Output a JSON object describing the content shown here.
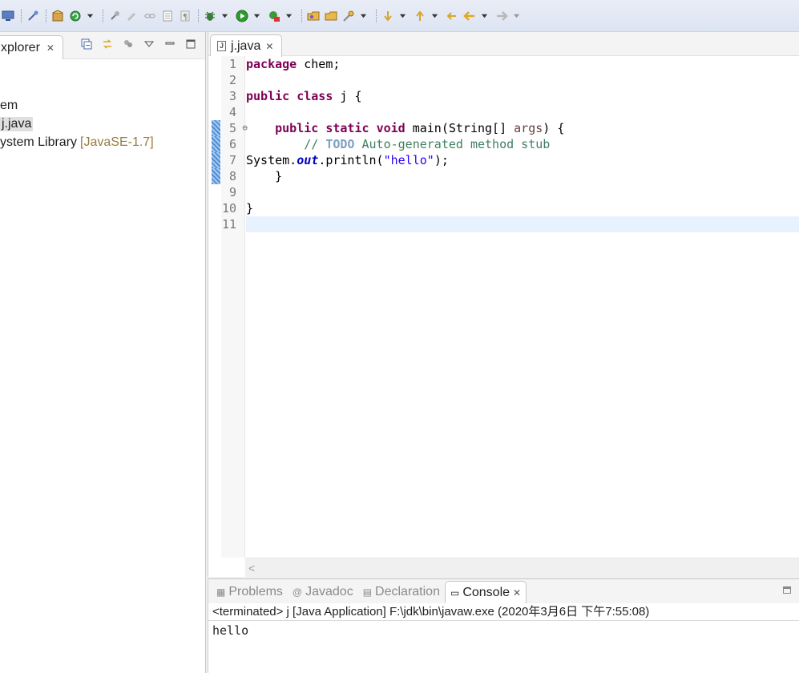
{
  "toolbar": {
    "icons": [
      "desktop-icon",
      "debug-pin-icon",
      "new-package-icon",
      "refresh-icon",
      "dropdown",
      "pin-icon",
      "brush-icon",
      "link-icon",
      "page-icon",
      "paragraph-icon",
      "debug-icon",
      "dropdown",
      "run-icon",
      "dropdown",
      "external-tools-icon",
      "dropdown",
      "open-type-icon",
      "open-folder-icon",
      "search-icon",
      "dropdown",
      "next-annotation-icon",
      "dropdown",
      "prev-annotation-icon",
      "dropdown",
      "last-edit-icon",
      "back-icon",
      "dropdown",
      "forward-icon",
      "dropdown"
    ],
    "colors": {
      "run": "#2e9b2e",
      "debug": "#3b7d3b",
      "folder": "#e8b84a",
      "arrow": "#d9a629"
    }
  },
  "explorer": {
    "tab_label": "xplorer",
    "tree": [
      {
        "label": "em",
        "decoration": ""
      },
      {
        "label": "j.java",
        "decoration": "",
        "selected": true
      },
      {
        "label": "ystem Library",
        "decoration": "[JavaSE-1.7]"
      }
    ]
  },
  "editor": {
    "tab_label": "j.java",
    "line_numbers": [
      "1",
      "2",
      "3",
      "4",
      "5",
      "6",
      "7",
      "8",
      "9",
      "10",
      "11"
    ],
    "lines": {
      "l1_kw": "package",
      "l1_rest": " chem;",
      "l3_kw1": "public",
      "l3_kw2": "class",
      "l3_rest": " j {",
      "l5_indent": "    ",
      "l5_kw1": "public",
      "l5_kw2": "static",
      "l5_kw3": "void",
      "l5_name": " main(String[] ",
      "l5_param": "args",
      "l5_end": ") {",
      "l6_indent": "        ",
      "l6_comment": "// ",
      "l6_todo": "TODO",
      "l6_rest": " Auto-generated method stub",
      "l7_pre": "System.",
      "l7_field": "out",
      "l7_mid": ".println(",
      "l7_str": "\"hello\"",
      "l7_end": ");",
      "l8": "    }",
      "l10": "}"
    },
    "scroll_arrow": "<"
  },
  "console": {
    "tabs": [
      "Problems",
      "Javadoc",
      "Declaration",
      "Console"
    ],
    "active_tab": "Console",
    "status": "<terminated> j [Java Application] F:\\jdk\\bin\\javaw.exe (2020年3月6日 下午7:55:08)",
    "output": "hello"
  }
}
